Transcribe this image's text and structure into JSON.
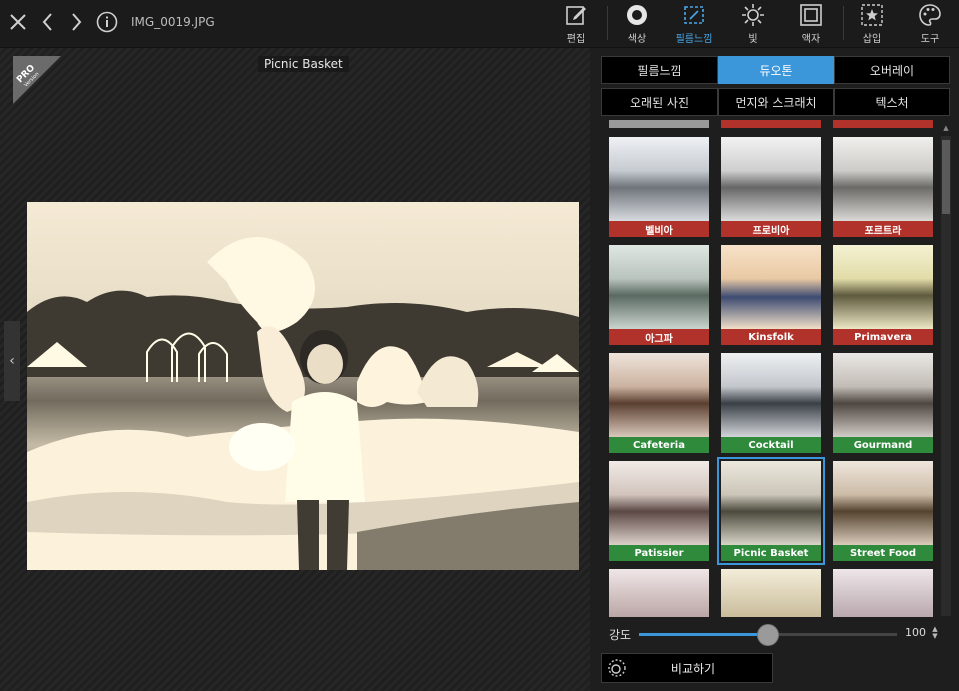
{
  "app": {
    "filename": "IMG_0019.JPG"
  },
  "toolbar": {
    "tools": [
      {
        "label": "편집",
        "icon": "edit-icon"
      },
      {
        "label": "색상",
        "icon": "color-circle-icon"
      },
      {
        "label": "필름느낌",
        "icon": "film-icon",
        "active": true
      },
      {
        "label": "빛",
        "icon": "sun-icon"
      },
      {
        "label": "액자",
        "icon": "frame-icon"
      },
      {
        "label": "삽입",
        "icon": "insert-star-icon"
      },
      {
        "label": "도구",
        "icon": "palette-icon"
      }
    ],
    "accent_color": "#3c96da"
  },
  "canvas": {
    "badge_top": "PRO",
    "badge_sub": "Version",
    "filter_caption": "Picnic Basket"
  },
  "tabs": [
    {
      "label": "필름느낌"
    },
    {
      "label": "듀오톤",
      "active": true
    },
    {
      "label": "오버레이"
    },
    {
      "label": "오래된 사진"
    },
    {
      "label": "먼지와 스크래치"
    },
    {
      "label": "텍스처"
    }
  ],
  "filters": [
    {
      "name": "벨비아",
      "color": "red"
    },
    {
      "name": "프로비아",
      "color": "red"
    },
    {
      "name": "포르트라",
      "color": "red"
    },
    {
      "name": "아그파",
      "color": "red"
    },
    {
      "name": "Kinsfolk",
      "color": "red"
    },
    {
      "name": "Primavera",
      "color": "red"
    },
    {
      "name": "Cafeteria",
      "color": "green"
    },
    {
      "name": "Cocktail",
      "color": "green"
    },
    {
      "name": "Gourmand",
      "color": "green"
    },
    {
      "name": "Patissier",
      "color": "green"
    },
    {
      "name": "Picnic Basket",
      "color": "green",
      "selected": true
    },
    {
      "name": "Street Food",
      "color": "green"
    }
  ],
  "intensity": {
    "label": "강도",
    "value": "100",
    "fraction": 0.5
  },
  "compare_button": {
    "label": "비교하기"
  }
}
